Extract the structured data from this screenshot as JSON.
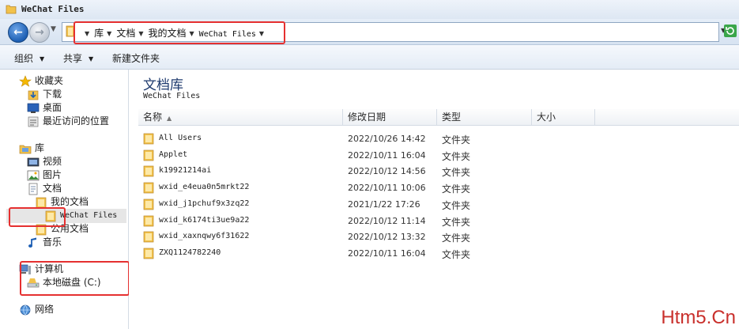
{
  "window": {
    "title": "WeChat Files"
  },
  "address": {
    "crumbs": [
      "库",
      "文档",
      "我的文档",
      "WeChat Files"
    ]
  },
  "toolbar": {
    "organize": "组织",
    "share": "共享",
    "new_folder": "新建文件夹"
  },
  "nav": {
    "favorites": {
      "label": "收藏夹",
      "items": [
        "下载",
        "桌面",
        "最近访问的位置"
      ]
    },
    "libraries": {
      "label": "库",
      "items": [
        "视频",
        "图片",
        "文档",
        "我的文档",
        "WeChat Files",
        "公用文档",
        "音乐"
      ]
    },
    "computer": {
      "label": "计算机",
      "drive": "本地磁盘 (C:)"
    },
    "network": {
      "label": "网络"
    }
  },
  "content": {
    "library_title": "文档库",
    "subtitle": "WeChat Files",
    "columns": [
      "名称",
      "修改日期",
      "类型",
      "大小"
    ],
    "rows": [
      {
        "name": "All Users",
        "date": "2022/10/26 14:42",
        "type": "文件夹"
      },
      {
        "name": "Applet",
        "date": "2022/10/11 16:04",
        "type": "文件夹"
      },
      {
        "name": "k19921214ai",
        "date": "2022/10/12 14:56",
        "type": "文件夹"
      },
      {
        "name": "wxid_e4eua0n5mrkt22",
        "date": "2022/10/11 10:06",
        "type": "文件夹"
      },
      {
        "name": "wxid_j1pchuf9x3zq22",
        "date": "2021/1/22 17:26",
        "type": "文件夹"
      },
      {
        "name": "wxid_k6174ti3ue9a22",
        "date": "2022/10/12 11:14",
        "type": "文件夹"
      },
      {
        "name": "wxid_xaxnqwy6f31622",
        "date": "2022/10/12 13:32",
        "type": "文件夹"
      },
      {
        "name": "ZXQ1124782240",
        "date": "2022/10/11 16:04",
        "type": "文件夹"
      }
    ]
  },
  "watermark": "Htm5.Cn",
  "colors": {
    "highlight": "#e53030",
    "folder": "#f2c24b",
    "accent": "#1d5fb4"
  }
}
